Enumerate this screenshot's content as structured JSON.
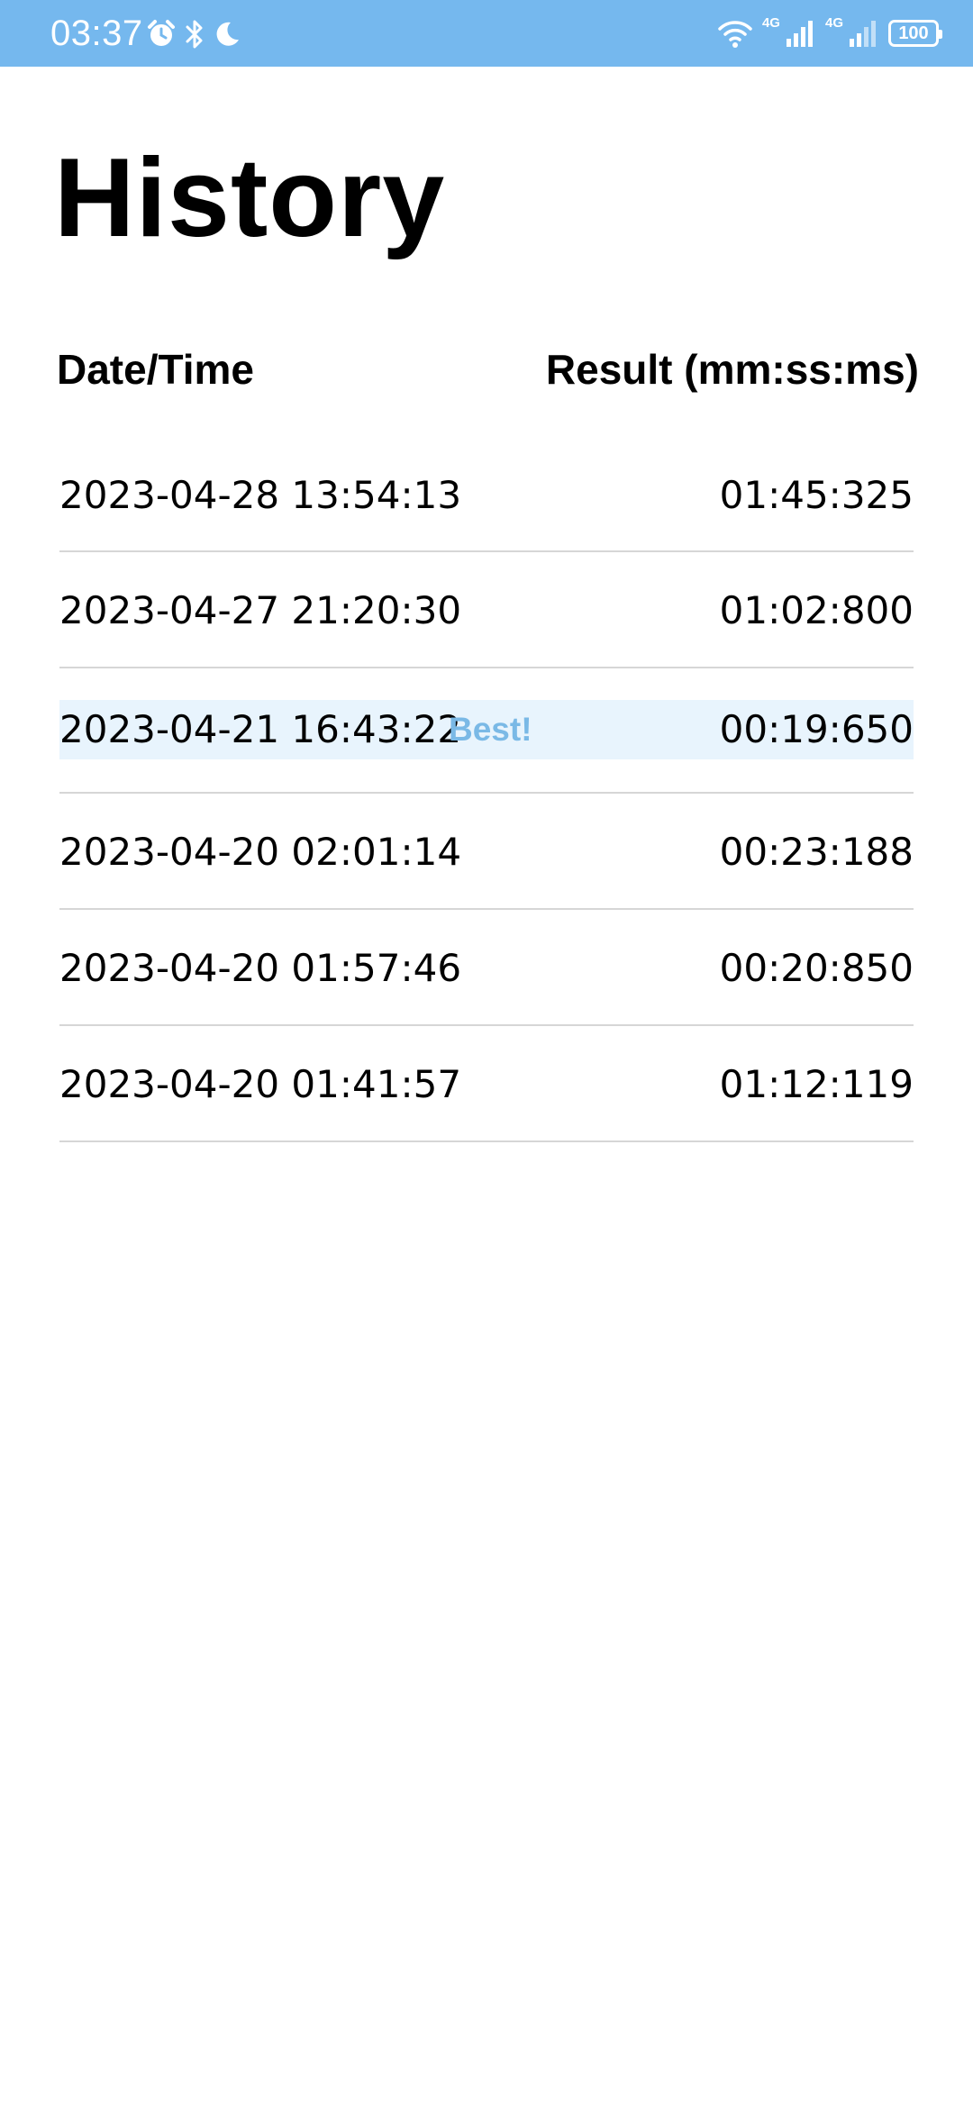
{
  "status_bar": {
    "time": "03:37",
    "network_label_1": "4G",
    "network_label_2": "4G",
    "battery": "100",
    "icons": [
      "alarm-icon",
      "bluetooth-icon",
      "moon-icon",
      "wifi-icon",
      "signal-icon",
      "signal-icon-2",
      "battery-icon"
    ],
    "background_color": "#75b8ee"
  },
  "page": {
    "title": "History"
  },
  "table": {
    "headers": {
      "date_time": "Date/Time",
      "result": "Result (mm:ss:ms)"
    },
    "rows": [
      {
        "date_time": "2023-04-28 13:54:13",
        "result": "01:45:325",
        "badge": ""
      },
      {
        "date_time": "2023-04-27 21:20:30",
        "result": "01:02:800",
        "badge": ""
      },
      {
        "date_time": "2023-04-21 16:43:22",
        "result": "00:19:650",
        "badge": "Best!"
      },
      {
        "date_time": "2023-04-20 02:01:14",
        "result": "00:23:188",
        "badge": ""
      },
      {
        "date_time": "2023-04-20 01:57:46",
        "result": "00:20:850",
        "badge": ""
      },
      {
        "date_time": "2023-04-20 01:41:57",
        "result": "01:12:119",
        "badge": ""
      }
    ],
    "best_highlight_color": "#e8f4fd",
    "best_badge_color": "#7ab9e6"
  }
}
